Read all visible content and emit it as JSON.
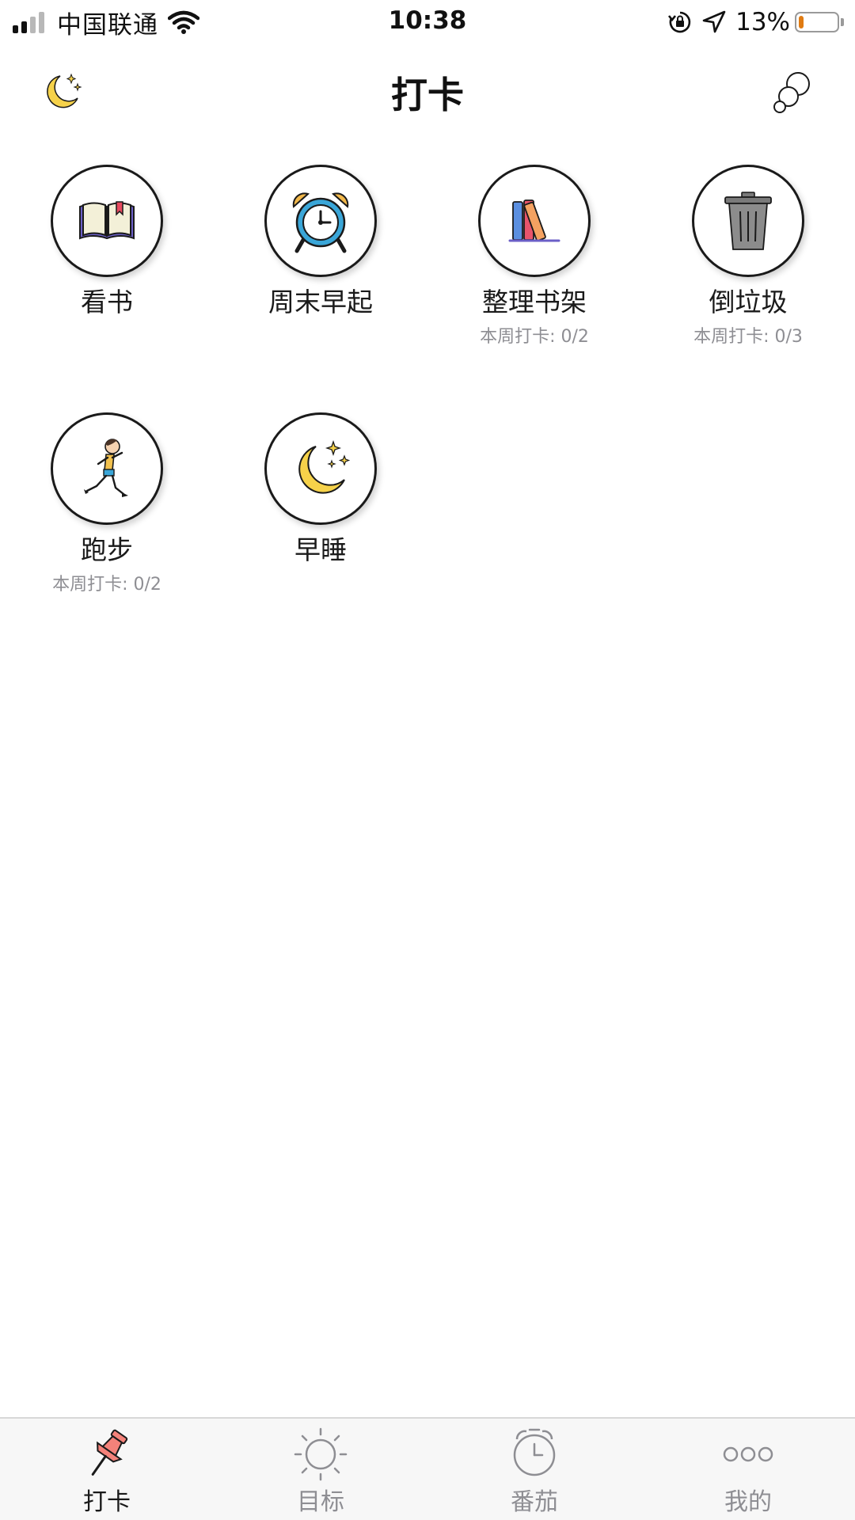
{
  "status_bar": {
    "carrier": "中国联通",
    "time": "10:38",
    "battery_percent": "13%",
    "battery_level": 0.13,
    "icons": [
      "signal-icon",
      "wifi-icon",
      "rotation-lock-icon",
      "location-arrow-icon",
      "battery-icon"
    ]
  },
  "nav": {
    "title": "打卡",
    "left_icon": "moon-stars-icon",
    "right_icon": "bubbles-icon"
  },
  "habits": [
    {
      "name": "看书",
      "sub": "",
      "icon": "open-book-icon"
    },
    {
      "name": "周末早起",
      "sub": "",
      "icon": "alarm-clock-icon"
    },
    {
      "name": "整理书架",
      "sub": "本周打卡: 0/2",
      "icon": "books-icon"
    },
    {
      "name": "倒垃圾",
      "sub": "本周打卡: 0/3",
      "icon": "trash-can-icon"
    },
    {
      "name": "跑步",
      "sub": "本周打卡: 0/2",
      "icon": "runner-icon"
    },
    {
      "name": "早睡",
      "sub": "",
      "icon": "crescent-moon-icon"
    }
  ],
  "tabs": [
    {
      "label": "打卡",
      "icon": "pushpin-icon",
      "active": true
    },
    {
      "label": "目标",
      "icon": "sun-icon",
      "active": false
    },
    {
      "label": "番茄",
      "icon": "clock-icon",
      "active": false
    },
    {
      "label": "我的",
      "icon": "dots-icon",
      "active": false
    }
  ],
  "colors": {
    "active_tab_icon": "#f4827a",
    "inactive": "#8e8e93",
    "battery_low": "#e07b12",
    "moon_yellow": "#f6d24a"
  }
}
